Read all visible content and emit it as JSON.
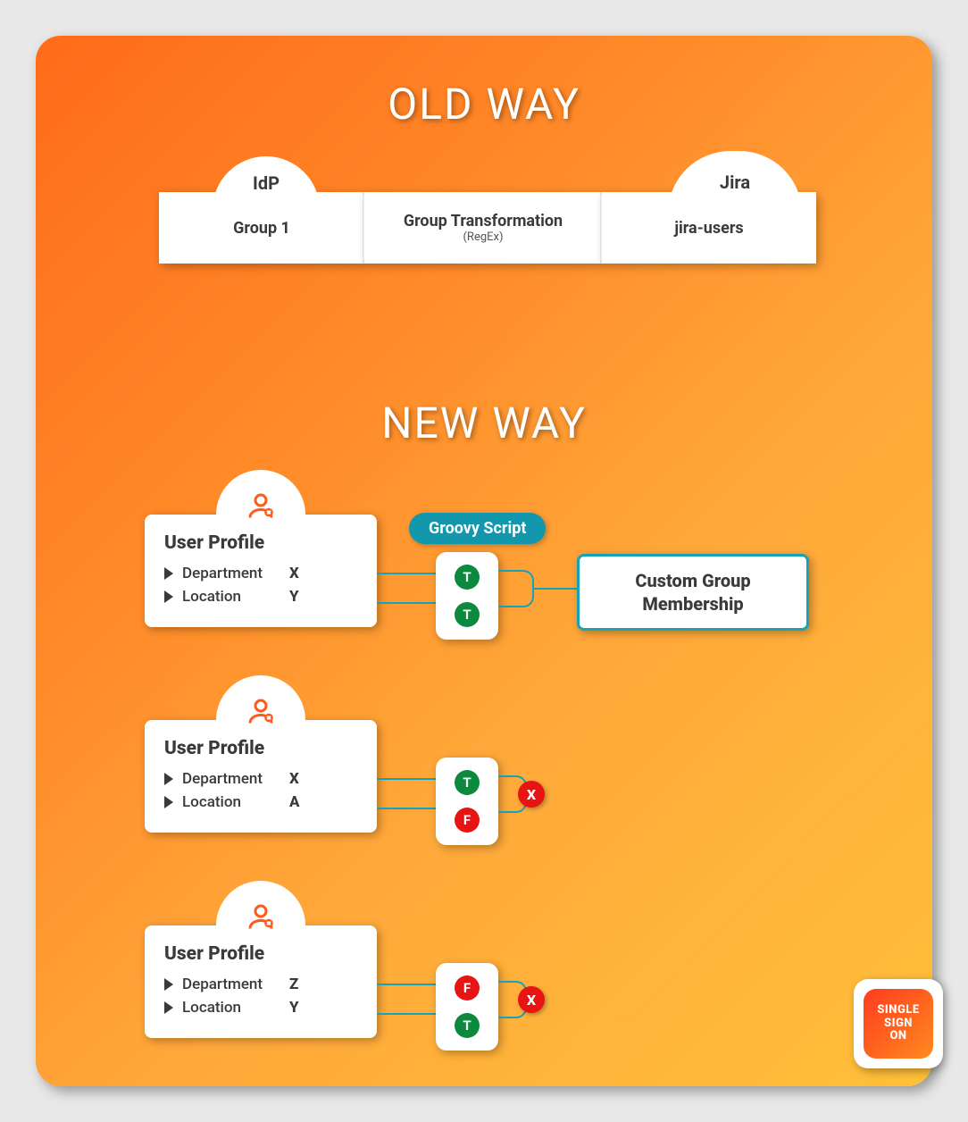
{
  "sections": {
    "old_title": "OLD WAY",
    "new_title": "NEW WAY"
  },
  "old": {
    "tab_left": "IdP",
    "tab_right": "Jira",
    "boxes": [
      {
        "label": "Group 1"
      },
      {
        "label": "Group Transformation",
        "sub": "(RegEx)"
      },
      {
        "label": "jira-users"
      }
    ]
  },
  "new": {
    "groovy_label": "Groovy Script",
    "custom_box": "Custom Group Membership",
    "profiles": [
      {
        "title": "User Profile",
        "attrs": [
          {
            "label": "Department",
            "value": "X",
            "result": "T"
          },
          {
            "label": "Location",
            "value": "Y",
            "result": "T"
          }
        ],
        "outcome": "pass"
      },
      {
        "title": "User Profile",
        "attrs": [
          {
            "label": "Department",
            "value": "X",
            "result": "T"
          },
          {
            "label": "Location",
            "value": "A",
            "result": "F"
          }
        ],
        "outcome": "fail"
      },
      {
        "title": "User Profile",
        "attrs": [
          {
            "label": "Department",
            "value": "Z",
            "result": "F"
          },
          {
            "label": "Location",
            "value": "Y",
            "result": "T"
          }
        ],
        "outcome": "fail"
      }
    ],
    "fail_badge": "X"
  },
  "icons": {
    "user": "user-x-icon",
    "triangle": "triangle-icon"
  },
  "logo": {
    "line1": "SINGLE",
    "line2": "SIGN",
    "line3": "ON"
  },
  "colors": {
    "teal": "#17a2b8",
    "green": "#0b8a3e",
    "red": "#e81313"
  }
}
